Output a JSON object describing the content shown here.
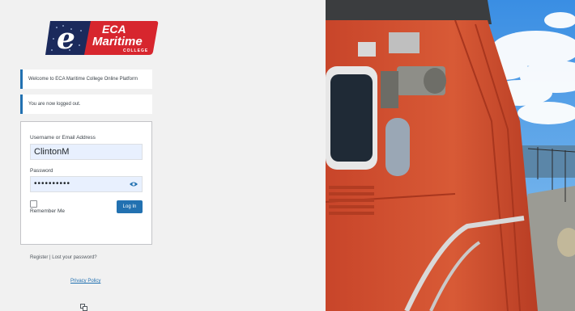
{
  "brand": {
    "logo_letter": "e",
    "line1": "ECA",
    "line2": "Maritime",
    "line3": "COLLEGE"
  },
  "notices": [
    {
      "text": "Welcome to ECA Maritime College Online Platform"
    },
    {
      "text": "You are now logged out."
    }
  ],
  "form": {
    "username_label": "Username or Email Address",
    "username_value": "ClintonM",
    "password_label": "Password",
    "password_value": "••••••••••",
    "remember_label": "Remember Me",
    "login_label": "Log In"
  },
  "links": {
    "register": "Register",
    "separator": "|",
    "lost_password": "Lost your password?",
    "privacy_policy": "Privacy Policy"
  },
  "colors": {
    "brand_navy": "#1b2a5c",
    "brand_red": "#d7262e",
    "accent_blue": "#2271b1",
    "lifeboat_orange": "#d2502e"
  }
}
